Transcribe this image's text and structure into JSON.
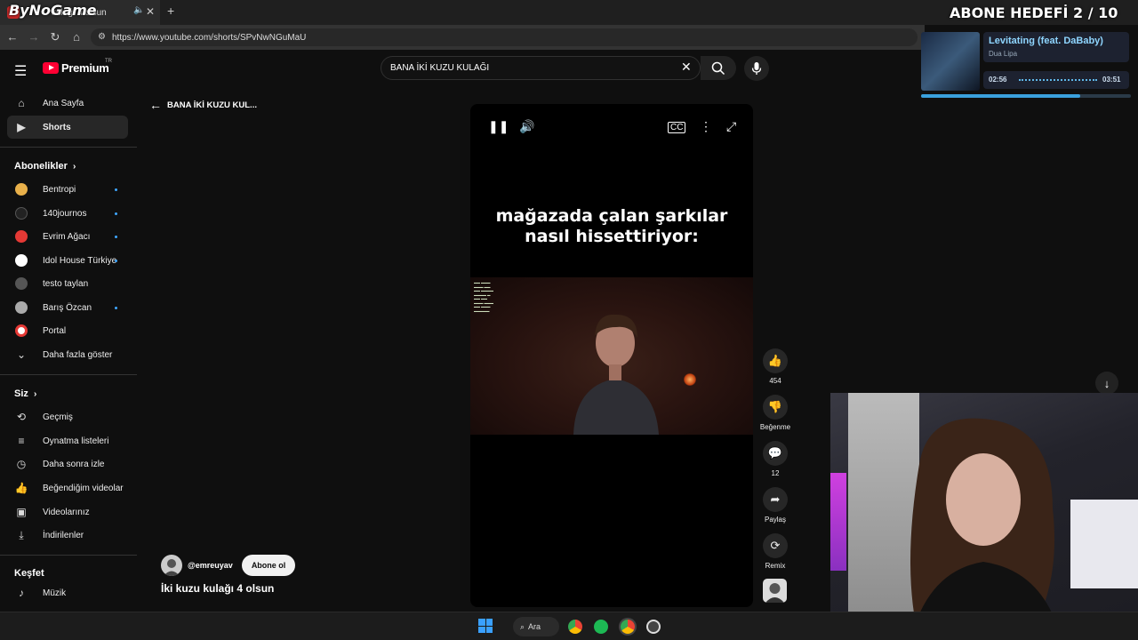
{
  "overlay": {
    "logo": "ByNoGame",
    "goal": "ABONE HEDEFİ 2 / 10",
    "music": {
      "title": "Levitating (feat. DaBaby)",
      "artist": "Dua Lipa",
      "elapsed": "02:56",
      "total": "03:51",
      "progress": 0.76
    }
  },
  "browser": {
    "tab_title": "kulağı 4 olsun",
    "url": "https://www.youtube.com/shorts/SPvNwNGuMaU"
  },
  "youtube": {
    "logo_text": "Premium",
    "region": "TR",
    "search_value": "BANA İKİ KUZU KULAĞI",
    "back_label": "BANA İKİ KUZU KUL...",
    "sidebar": {
      "main": [
        {
          "label": "Ana Sayfa",
          "icon": "home-icon"
        },
        {
          "label": "Shorts",
          "icon": "shorts-icon"
        }
      ],
      "subs_header": "Abonelikler",
      "subs": [
        {
          "label": "Bentropi",
          "color": "#e8b04a",
          "dot": true
        },
        {
          "label": "140journos",
          "color": "#222222",
          "dot": true
        },
        {
          "label": "Evrim Ağacı",
          "color": "#e53935",
          "dot": true
        },
        {
          "label": "Idol House Türkiye",
          "color": "#ffffff",
          "dot": true
        },
        {
          "label": "testo taylan",
          "color": "#555555",
          "dot": false
        },
        {
          "label": "Barış Özcan",
          "color": "#aaaaaa",
          "dot": true
        },
        {
          "label": "Portal",
          "color": "#e53935",
          "dot": false
        },
        {
          "label": "Daha fazla göster",
          "color": "",
          "dot": false
        }
      ],
      "you_header": "Siz",
      "you": [
        {
          "label": "Geçmiş",
          "icon": "history-icon"
        },
        {
          "label": "Oynatma listeleri",
          "icon": "playlist-icon"
        },
        {
          "label": "Daha sonra izle",
          "icon": "clock-icon"
        },
        {
          "label": "Beğendiğim videolar",
          "icon": "like-icon"
        },
        {
          "label": "Videolarınız",
          "icon": "video-icon"
        },
        {
          "label": "İndirilenler",
          "icon": "download-icon"
        }
      ],
      "explore_header": "Keşfet",
      "explore": [
        {
          "label": "Müzik",
          "icon": "music-icon"
        }
      ]
    },
    "short": {
      "caption": "mağazada çalan şarkılar nasıl hissettiriyor:",
      "channel": "@emreuyav",
      "subscribe": "Abone ol",
      "title": "İki kuzu kulağı 4 olsun"
    },
    "actions": {
      "likes": "454",
      "dislike": "Beğenme",
      "comments": "12",
      "share": "Paylaş",
      "remix": "Remix"
    }
  },
  "taskbar": {
    "search": "Ara"
  }
}
